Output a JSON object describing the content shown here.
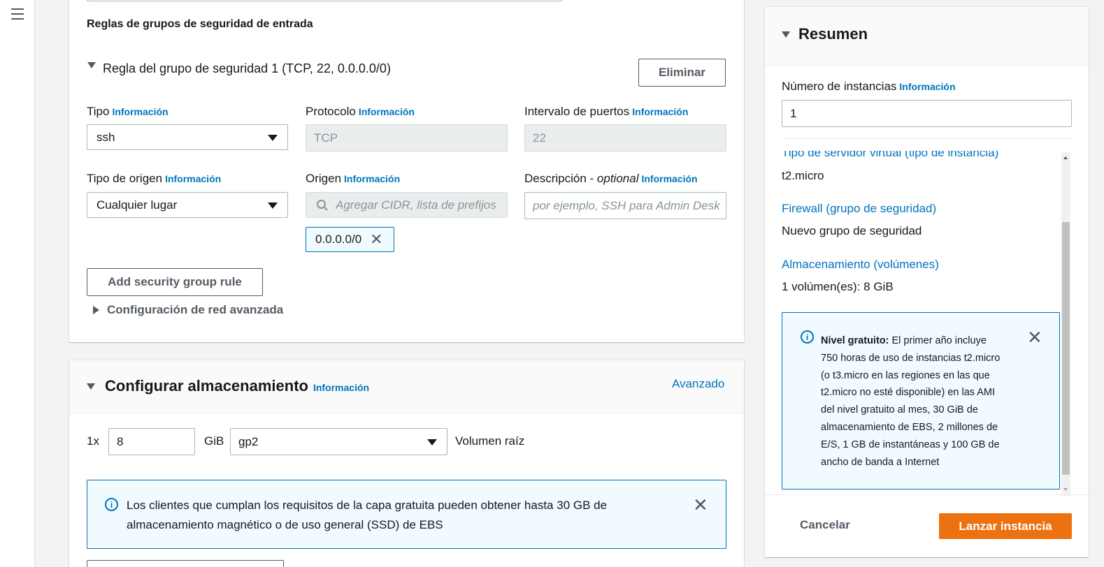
{
  "network": {
    "inbound_rules_heading": "Reglas de grupos de seguridad de entrada",
    "rule_title": "Regla del grupo de seguridad 1 (TCP, 22, 0.0.0.0/0)",
    "delete_button": "Eliminar",
    "info_link": "Información",
    "type_label": "Tipo",
    "type_value": "ssh",
    "protocol_label": "Protocolo",
    "protocol_value": "TCP",
    "port_range_label": "Intervalo de puertos",
    "port_range_value": "22",
    "source_type_label": "Tipo de origen",
    "source_type_value": "Cualquier lugar",
    "source_label": "Origen",
    "source_placeholder": "Agregar CIDR, lista de prefijos",
    "source_token": "0.0.0.0/0",
    "description_label": "Descripción - ",
    "description_optional": "optional",
    "description_placeholder": "por ejemplo, SSH para Admin Desk",
    "add_rule_button": "Add security group rule",
    "advanced_network": "Configuración de red avanzada"
  },
  "storage": {
    "title": "Configurar almacenamiento",
    "info_link": "Información",
    "advanced_link": "Avanzado",
    "multiplier": "1x",
    "size_value": "8",
    "unit": "GiB",
    "volume_type": "gp2",
    "volume_label": "Volumen raíz",
    "alert_text": "Los clientes que cumplan los requisitos de la capa gratuita pueden obtener hasta 30 GB de almacenamiento magnético o de uso general (SSD) de EBS"
  },
  "summary": {
    "title": "Resumen",
    "instances_label": "Número de instancias",
    "info_link": "Información",
    "instances_value": "1",
    "instance_type_link": "Tipo de servidor virtual (tipo de instancia)",
    "instance_type_value": "t2.micro",
    "firewall_link": "Firewall (grupo de seguridad)",
    "firewall_value": "Nuevo grupo de seguridad",
    "storage_link": "Almacenamiento (volúmenes)",
    "storage_value": "1 volúmen(es): 8 GiB",
    "free_tier_bold": "Nivel gratuito:",
    "free_tier_lines": [
      "El primer año incluye",
      "750 horas de uso de instancias t2.micro",
      "(o t3.micro en las regiones en las que",
      "t2.micro no esté disponible) en las AMI",
      "del nivel gratuito al mes, 30 GiB de",
      "almacenamiento de EBS, 2 millones de",
      "E/S, 1 GB de instantáneas y 100 GB de",
      "ancho de banda a Internet"
    ],
    "cancel_button": "Cancelar",
    "launch_button": "Lanzar instancia"
  },
  "colors": {
    "link": "#0073bb",
    "primary": "#ec7211",
    "alert_bg": "#f1faff"
  }
}
